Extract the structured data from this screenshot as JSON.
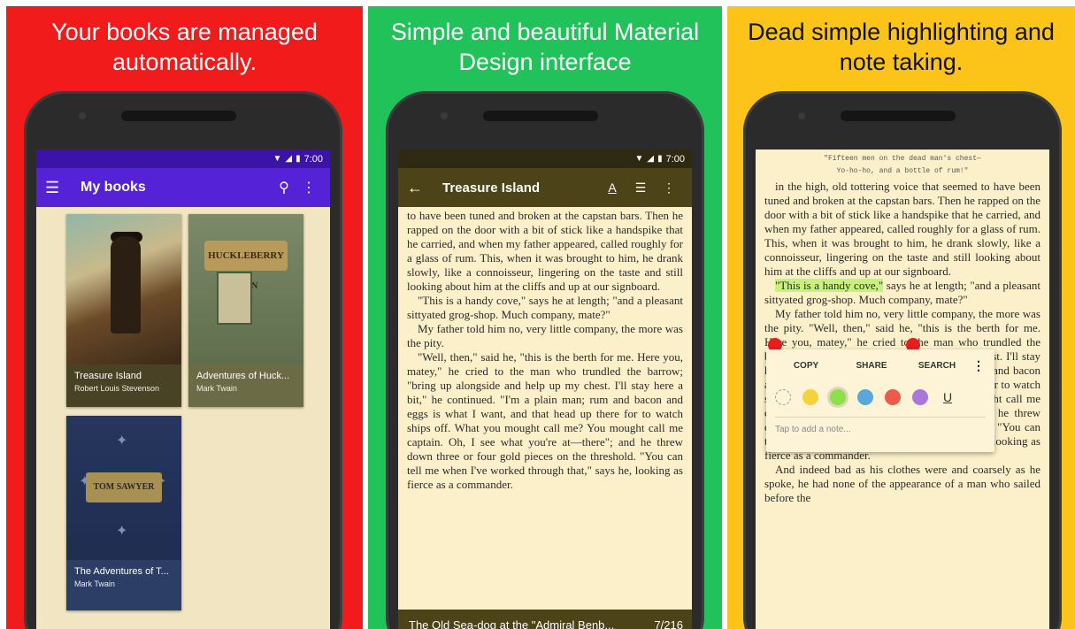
{
  "panels": [
    {
      "headline": "Your books are managed automatically.",
      "status_time": "7:00",
      "app_title": "My books",
      "books": [
        {
          "title": "Treasure Island",
          "author": "Robert Louis Stevenson",
          "cover_text": ""
        },
        {
          "title": "Adventures of Huck...",
          "author": "Mark Twain",
          "cover_text": "HUCKLEBERRY FINN"
        },
        {
          "title": "The Adventures of T...",
          "author": "Mark Twain",
          "cover_text": "TOM SAWYER"
        }
      ]
    },
    {
      "headline": "Simple and beautiful Material Design interface",
      "status_time": "7:00",
      "book_title": "Treasure Island",
      "chapter": "The Old Sea-dog at the \"Admiral Benb...",
      "page": "7/216",
      "progress": 0.03,
      "paragraphs": [
        "to have been tuned and broken at the capstan bars. Then he rapped on the door with a bit of stick like a handspike that he carried, and when my father appeared, called roughly for a glass of rum. This, when it was brought to him, he drank slowly, like a connoisseur, lingering on the taste and still looking about him at the cliffs and up at our signboard.",
        "\"This is a handy cove,\" says he at length; \"and a pleasant sittyated grog-shop. Much company, mate?\"",
        "My father told him no, very little company, the more was the pity.",
        "\"Well, then,\" said he, \"this is the berth for me. Here you, matey,\" he cried to the man who trundled the barrow; \"bring up alongside and help up my chest. I'll stay here a bit,\" he continued. \"I'm a plain man; rum and bacon and eggs is what I want, and that head up there for to watch ships off. What you mought call me? You mought call me captain. Oh, I see what you're at—there\"; and he threw down three or four gold pieces on the threshold. \"You can tell me when I've worked through that,\" says he, looking as fierce as a commander."
      ]
    },
    {
      "headline": "Dead simple highlighting and note taking.",
      "epigraph_1": "\"Fifteen men on the dead man's chest—",
      "epigraph_2": "Yo-ho-ho, and a bottle of rum!\"",
      "para_1": "in the high, old tottering voice that seemed to have been tuned and broken at the capstan bars. Then he rapped on the door with a bit of stick like a handspike that he carried, and when my father appeared, called roughly for a glass of rum. This, when it was brought to him, he drank slowly, like a connoisseur, lingering on the taste and still looking about him at the cliffs and up at our signboard.",
      "highlight": "\"This is a handy cove,\"",
      "para_2_rest": " says he at length; \"and a pleasant sittyated grog-shop. Much company, mate?\"",
      "para_3": "My father told him no, very little company, the more was the pity. \"Well, then,\" said he, \"this is the berth for me. Here you, matey,\" he cried to the man who trundled the barrow; \"bring up alongside and help up my chest. I'll stay here a bit,\" he continued. \"I'm a plain man; rum and bacon and eggs is what I want, and that head up there for to watch ships off. What you mought call me? You mought call me captain. Oh, I see what you're at—there\"; and he threw down three or four gold pieces on the threshold. \"You can tell me when I've worked through that,\" says he, looking as fierce as a commander.",
      "para_4": "And indeed bad as his clothes were and coarsely as he spoke, he had none of the appearance of a man who sailed before the",
      "popup": {
        "copy": "COPY",
        "share": "SHARE",
        "search": "SEARCH",
        "note_placeholder": "Tap to add a note...",
        "colors": [
          "#f3d23b",
          "#8ee04a",
          "#5aa7dc",
          "#ec5a4a",
          "#a878d8"
        ],
        "selected_color": "#8ee04a"
      }
    }
  ],
  "colors": {
    "panel_red": "#f21b1b",
    "panel_green": "#22c25a",
    "panel_yellow": "#fcc318",
    "appbar_purple": "#5522d8",
    "appbar_brown": "#4d4318",
    "paper": "#fbf0c9",
    "highlight": "#c8f07a"
  }
}
